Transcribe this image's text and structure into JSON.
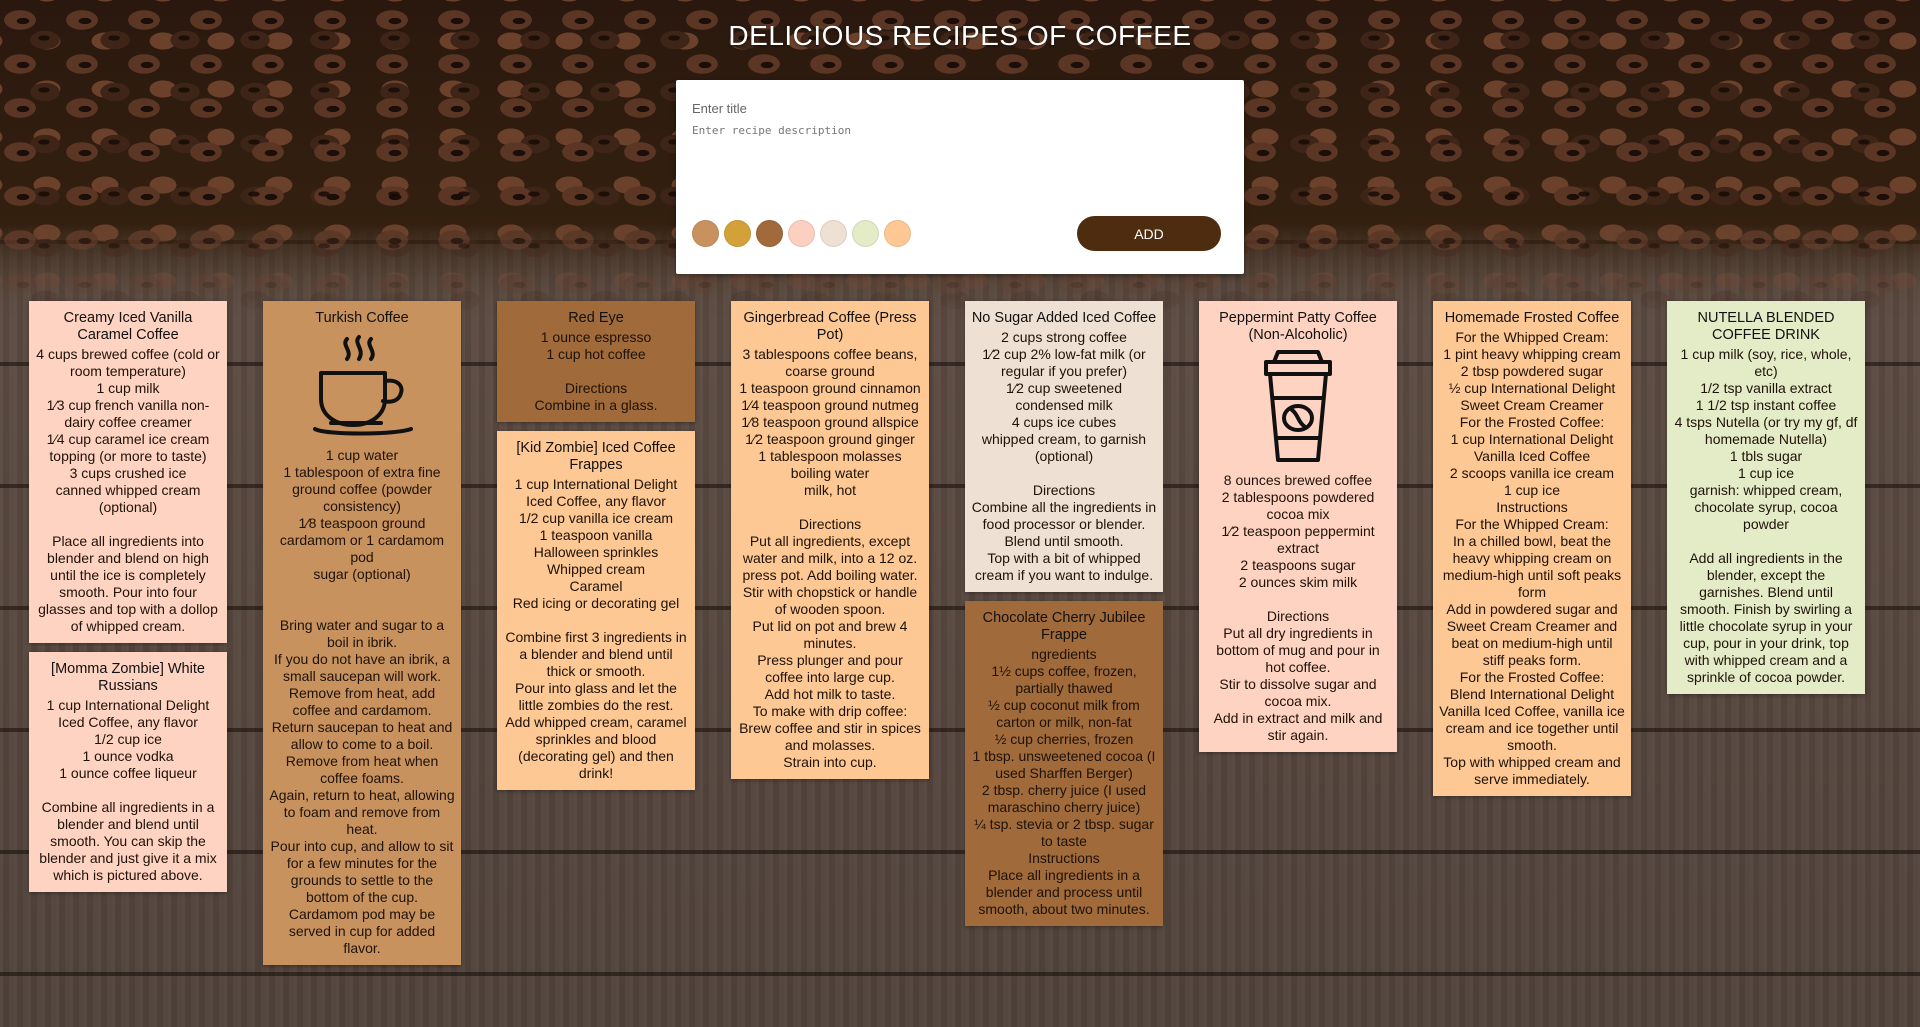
{
  "page": {
    "title": "DELICIOUS RECIPES OF COFFEE"
  },
  "form": {
    "title_placeholder": "Enter title",
    "description_placeholder": "Enter recipe description",
    "add_label": "ADD",
    "add_color": "#4d2c0f",
    "swatches": [
      "#c8925f",
      "#d4a03a",
      "#a06a3a",
      "#fcd0c0",
      "#eee0d2",
      "#e4ebc7",
      "#fdc893"
    ]
  },
  "cards": {
    "c1": {
      "title": "Creamy Iced Vanilla Caramel Coffee",
      "color": "#ffd3c2",
      "body": "4 cups brewed coffee (cold or room temperature)\n1 cup milk\n1⁄3 cup french vanilla non-dairy coffee creamer\n1⁄4 cup caramel ice cream topping (or more to taste)\n3 cups crushed ice\ncanned whipped cream (optional)\n\nPlace all ingredients into blender and blend on high until the ice is completely smooth. Pour into four glasses and top with a dollop of whipped cream."
    },
    "c2": {
      "title": "[Momma Zombie] White Russians",
      "color": "#ffd3c2",
      "body": "1 cup International Delight Iced Coffee, any flavor\n1/2 cup ice\n1 ounce vodka\n1 ounce coffee liqueur\n\nCombine all ingredients in a blender and blend until smooth. You can skip the blender and just give it a mix which is pictured above."
    },
    "c3": {
      "title": "Turkish Coffee",
      "color": "#c8925f",
      "icon": "coffee-cup-icon",
      "body": "1 cup water\n1 tablespoon of extra fine ground coffee (powder consistency)\n1⁄8 teaspoon ground cardamom or 1 cardamom pod\nsugar (optional)\n\n\nBring water and sugar to a boil in ibrik.\nIf you do not have an ibrik, a small saucepan will work.\nRemove from heat, add coffee and cardamom.\nReturn saucepan to heat and allow to come to a boil.\nRemove from heat when coffee foams.\nAgain, return to heat, allowing to foam and remove from heat.\nPour into cup, and allow to sit for a few minutes for the grounds to settle to the bottom of the cup.\nCardamom pod may be served in cup for added flavor."
    },
    "c4": {
      "title": "Red Eye",
      "color": "#a06a3a",
      "body": "1 ounce espresso\n1 cup hot coffee\n\nDirections\nCombine in a glass."
    },
    "c5": {
      "title": "[Kid Zombie] Iced Coffee Frappes",
      "color": "#fdc893",
      "body": "1 cup International Delight Iced Coffee, any flavor\n1/2 cup vanilla ice cream\n1 teaspoon vanilla\nHalloween sprinkles\nWhipped cream\nCaramel\nRed icing or decorating gel\n\nCombine first 3 ingredients in a blender and blend until thick or smooth.\nPour into glass and let the little zombies do the rest.\nAdd whipped cream, caramel sprinkles and blood (decorating gel) and then drink!"
    },
    "c6": {
      "title": "Gingerbread Coffee (Press Pot)",
      "color": "#fdc893",
      "body": "3 tablespoons coffee beans, coarse ground\n1 teaspoon ground cinnamon\n1⁄4 teaspoon ground nutmeg\n1⁄8 teaspoon ground allspice\n1⁄2 teaspoon ground ginger\n1 tablespoon molasses\nboiling water\nmilk, hot\n\nDirections\nPut all ingredients, except water and milk, into a 12 oz. press pot. Add boiling water. Stir with chopstick or handle of wooden spoon.\nPut lid on pot and brew 4 minutes.\nPress plunger and pour coffee into large cup.\nAdd hot milk to taste.\nTo make with drip coffee: Brew coffee and stir in spices and molasses.\nStrain into cup."
    },
    "c7": {
      "title": "No Sugar Added Iced Coffee",
      "color": "#eee0d2",
      "body": "2 cups strong coffee\n1⁄2 cup 2% low-fat milk (or regular if you prefer)\n1⁄2 cup sweetened condensed milk\n4 cups ice cubes\nwhipped cream, to garnish (optional)\n\nDirections\nCombine all the ingredients in food processor or blender.\nBlend until smooth.\nTop with a bit of whipped cream if you want to indulge."
    },
    "c8": {
      "title": "Chocolate Cherry Jubilee Frappe",
      "color": "#a06a3a",
      "body": "ngredients\n1½ cups coffee, frozen, partially thawed\n½ cup coconut milk from carton or milk, non-fat\n½ cup cherries, frozen\n1 tbsp. unsweetened cocoa (I used Sharffen Berger)\n2 tbsp. cherry juice (I used maraschino cherry juice)\n¼ tsp. stevia or 2 tbsp. sugar to taste\nInstructions\nPlace all ingredients in a blender and process until smooth, about two minutes."
    },
    "c9": {
      "title": "Peppermint Patty Coffee (Non-Alcoholic)",
      "color": "#ffd3c2",
      "icon": "takeaway-coffee-cup-icon",
      "body": "8 ounces brewed coffee\n2 tablespoons powdered cocoa mix\n1⁄2 teaspoon peppermint extract\n2 teaspoons sugar\n2 ounces skim milk\n\nDirections\nPut all dry ingredients in bottom of mug and pour in hot coffee.\nStir to dissolve sugar and cocoa mix.\nAdd in extract and milk and stir again."
    },
    "c10": {
      "title": "Homemade Frosted Coffee",
      "color": "#fdc893",
      "body": "For the Whipped Cream:\n1 pint heavy whipping cream\n2 tbsp powdered sugar\n½ cup International Delight Sweet Cream Creamer\nFor the Frosted Coffee:\n1 cup International Delight Vanilla Iced Coffee\n2 scoops vanilla ice cream\n1 cup ice\nInstructions\nFor the Whipped Cream:\nIn a chilled bowl, beat the heavy whipping cream on medium-high until soft peaks form\nAdd in powdered sugar and Sweet Cream Creamer and beat on medium-high until stiff peaks form.\nFor the Frosted Coffee:\nBlend International Delight Vanilla Iced Coffee, vanilla ice cream and ice together until smooth.\nTop with whipped cream and serve immediately."
    },
    "c11": {
      "title": "NUTELLA  BLENDED COFFEE DRINK",
      "color": "#e4ebc7",
      "body": "1 cup milk (soy, rice, whole, etc)\n1/2 tsp vanilla extract\n1 1/2 tsp instant coffee\n4 tsps Nutella (or try my gf, df homemade Nutella)\n1 tbls sugar\n1 cup ice\ngarnish: whipped cream, chocolate syrup, cocoa powder\n\nAdd all ingredients in the blender, except the garnishes.  Blend until smooth.  Finish by swirling a little chocolate syrup in your cup, pour in your drink, top with whipped cream and a sprinkle of cocoa powder."
    }
  }
}
